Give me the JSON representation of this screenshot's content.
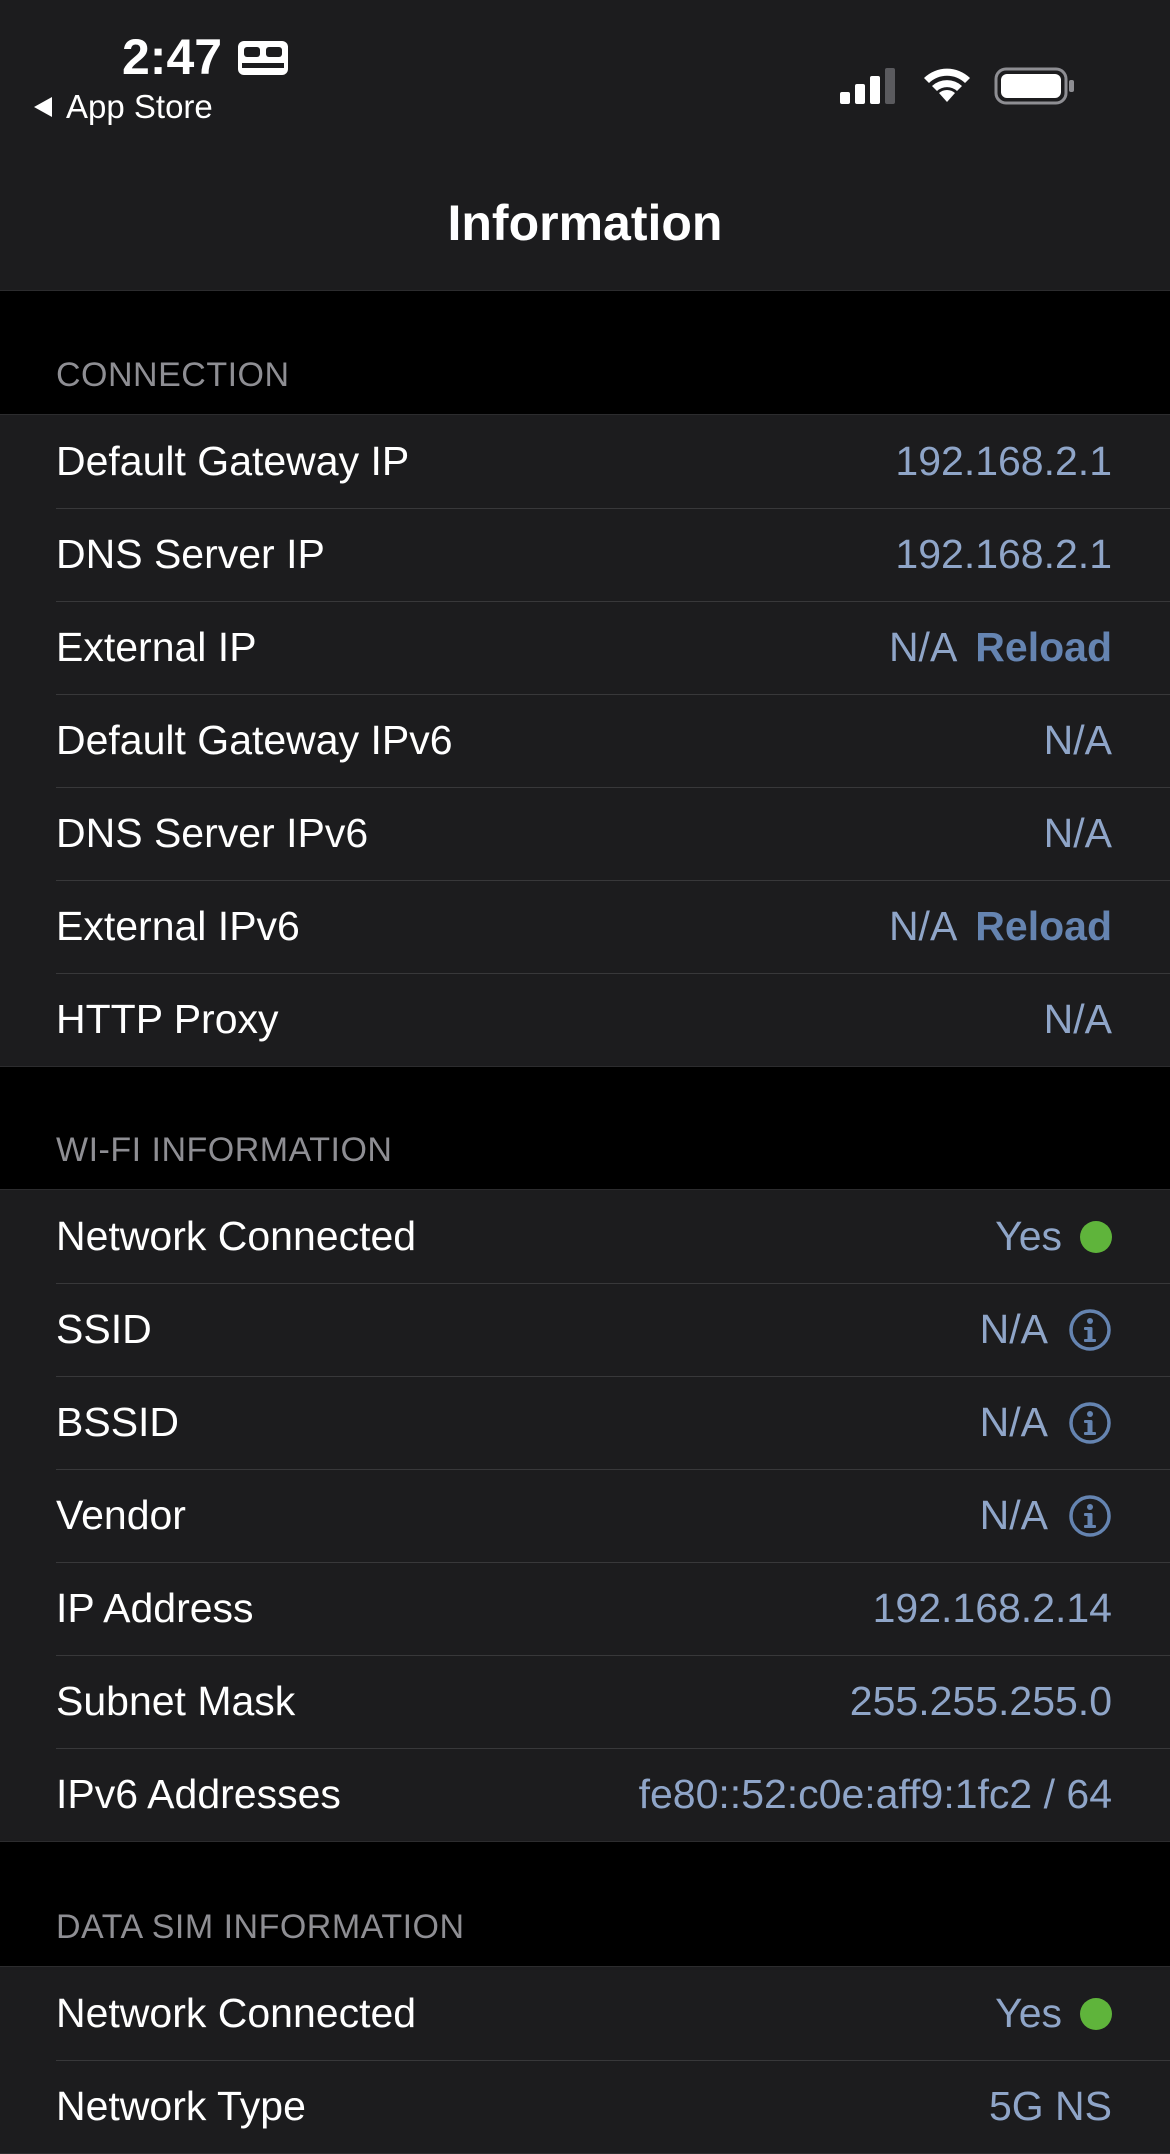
{
  "status_bar": {
    "time": "2:47",
    "focus_icon": "bed-icon",
    "back_label": "App Store",
    "icons": [
      "signal-icon",
      "wifi-icon",
      "battery-icon"
    ]
  },
  "nav": {
    "title": "Information"
  },
  "colors": {
    "background": "#000000",
    "cell": "#1c1c1e",
    "value_text": "#8fa5c8",
    "action_text": "#6584b1",
    "connected_dot": "#5fb43b",
    "section_header": "#8e8e93"
  },
  "connection": {
    "header": "CONNECTION",
    "rows": [
      {
        "label": "Default Gateway IP",
        "value": "192.168.2.1"
      },
      {
        "label": "DNS Server IP",
        "value": "192.168.2.1"
      },
      {
        "label": "External IP",
        "value": "N/A",
        "action": "Reload"
      },
      {
        "label": "Default Gateway IPv6",
        "value": "N/A"
      },
      {
        "label": "DNS Server IPv6",
        "value": "N/A"
      },
      {
        "label": "External IPv6",
        "value": "N/A",
        "action": "Reload"
      },
      {
        "label": "HTTP Proxy",
        "value": "N/A"
      }
    ]
  },
  "wifi": {
    "header": "WI-FI INFORMATION",
    "rows": [
      {
        "label": "Network Connected",
        "value": "Yes",
        "indicator": "green-dot"
      },
      {
        "label": "SSID",
        "value": "N/A",
        "icon": "info-icon"
      },
      {
        "label": "BSSID",
        "value": "N/A",
        "icon": "info-icon"
      },
      {
        "label": "Vendor",
        "value": "N/A",
        "icon": "info-icon"
      },
      {
        "label": "IP Address",
        "value": "192.168.2.14"
      },
      {
        "label": "Subnet Mask",
        "value": "255.255.255.0"
      },
      {
        "label": "IPv6 Addresses",
        "value": "fe80::52:c0e:aff9:1fc2 / 64"
      }
    ]
  },
  "data_sim": {
    "header": "DATA SIM INFORMATION",
    "rows": [
      {
        "label": "Network Connected",
        "value": "Yes",
        "indicator": "green-dot"
      },
      {
        "label": "Network Type",
        "value": "5G NS"
      }
    ]
  }
}
